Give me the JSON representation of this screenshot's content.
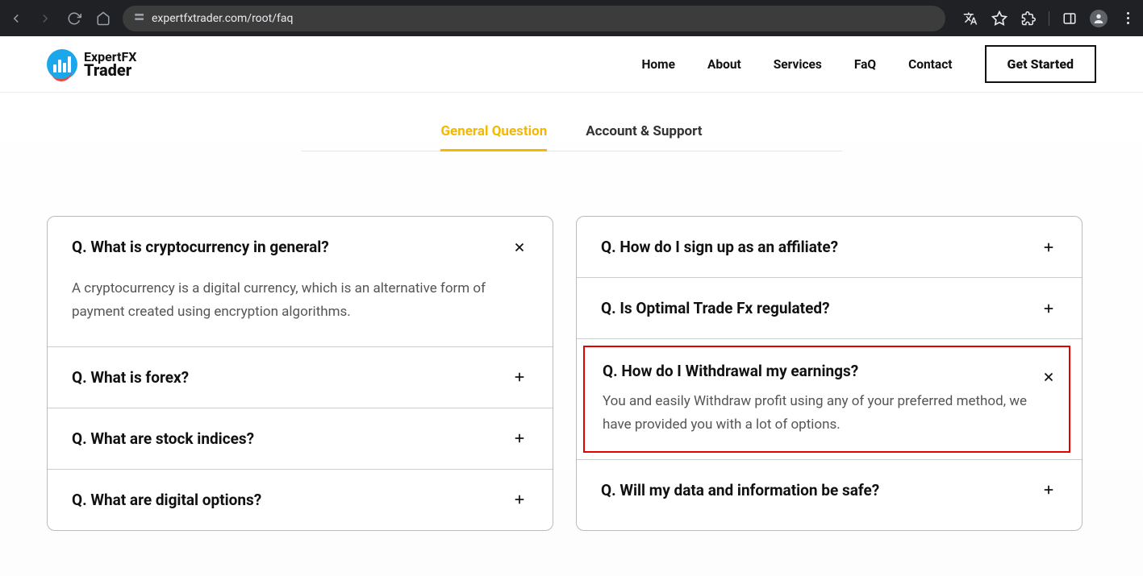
{
  "browser": {
    "url": "expertfxtrader.com/root/faq"
  },
  "logo": {
    "line1": "ExpertFX",
    "line2": "Trader"
  },
  "nav": {
    "home": "Home",
    "about": "About",
    "services": "Services",
    "faq": "FaQ",
    "contact": "Contact",
    "cta": "Get Started"
  },
  "tabs": {
    "general": "General Question",
    "account": "Account & Support"
  },
  "faq_left": [
    {
      "q": "Q. What is cryptocurrency in general?",
      "a": "A cryptocurrency is a digital currency, which is an alternative form of payment created using encryption algorithms.",
      "expanded": true
    },
    {
      "q": "Q. What is forex?",
      "expanded": false
    },
    {
      "q": "Q. What are stock indices?",
      "expanded": false
    },
    {
      "q": "Q. What are digital options?",
      "expanded": false
    }
  ],
  "faq_right": [
    {
      "q": "Q. How do I sign up as an affiliate?",
      "expanded": false
    },
    {
      "q": "Q. Is Optimal Trade Fx regulated?",
      "expanded": false
    },
    {
      "q": "Q. How do I Withdrawal my earnings?",
      "a": "You and easily Withdraw profit using any of your preferred method, we have provided you with a lot of options.",
      "expanded": true,
      "highlighted": true
    },
    {
      "q": "Q. Will my data and information be safe?",
      "expanded": false
    }
  ]
}
